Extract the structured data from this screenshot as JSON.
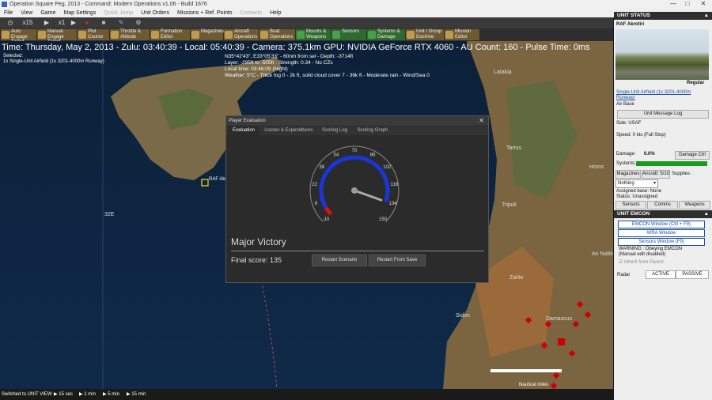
{
  "window": {
    "title": "Operation Square Peg, 2013 - Command: Modern Operations v1.06 - Build 1676",
    "min": "—",
    "max": "□",
    "close": "✕"
  },
  "menu": [
    "File",
    "View",
    "Game",
    "Map Settings",
    "Quick Jump",
    "Unit Orders",
    "Missions + Ref. Points",
    "Contacts",
    "Help"
  ],
  "menu_disabled": [
    false,
    false,
    false,
    false,
    true,
    false,
    false,
    true,
    false
  ],
  "toolbar1": {
    "speed_label": "x15",
    "speed2_label": "x1"
  },
  "toolbar2": [
    {
      "label": "Auto Engage Target",
      "color": "brown"
    },
    {
      "label": "Manual Engage Target",
      "color": "brown"
    },
    {
      "label": "Plot Course",
      "color": "brown"
    },
    {
      "label": "Throttle & Altitude",
      "color": "brown"
    },
    {
      "label": "Formation Editor",
      "color": "brown"
    },
    {
      "label": "Magazines",
      "color": "brown"
    },
    {
      "label": "Aircraft Operations",
      "color": "brown"
    },
    {
      "label": "Boat Operations",
      "color": "brown"
    },
    {
      "label": "Mounts & Weapons",
      "color": "green"
    },
    {
      "label": "Sensors",
      "color": "green"
    },
    {
      "label": "Systems & Damage",
      "color": "green"
    },
    {
      "label": "Unit / Group Doctrine",
      "color": "brown"
    },
    {
      "label": "Mission Editor",
      "color": "brown"
    }
  ],
  "status": {
    "line": "Time: Thursday, May 2, 2013 - Zulu: 03:40:39 - Local: 05:40:39 - Camera: 375.1km GPU: NVIDIA GeForce RTX 4060 - AU Count: 160 - Pulse Time: 0ms"
  },
  "selected": {
    "line1": "Selected:",
    "line2": "1x Single-Unit Airfield (1x 3201-4000m Runway)"
  },
  "cursor_info": {
    "line1": "N35°42'43\", E33°05'33\" - 60nm from sel - Depth: -3714ft",
    "line2": "Layer: -295ft to -505ft - Strength: 0.34 - No CZs",
    "line3": "Local time: 03:46:09 (Night)",
    "line4": "Weather: 5°C - Thick fog 0 - 2k ft, solid cloud cover 7 - 36k ft - Moderate rain - Wind/Sea 0"
  },
  "map_labels": {
    "latakia": "Latakia",
    "tartus": "Tartus",
    "homs": "Homs",
    "tripoli": "Tripoli",
    "zahle": "Zahle",
    "sidon": "Sidon",
    "an_nabk": "An Nabk",
    "damascus": "Damascus",
    "lon": "32E",
    "airfield": "RAF Akr...",
    "scale": "Nautical miles"
  },
  "bottom": {
    "status": "Switched to UNIT VIEW",
    "t1": "15 sec",
    "t2": "1 min",
    "t3": "5 min",
    "t4": "15 min"
  },
  "dialog": {
    "title": "Player Evaluation",
    "tabs": [
      "Evaluation",
      "Losses & Expenditures",
      "Scoring Log",
      "Scoring Graph"
    ],
    "gauge_ticks": [
      "-10",
      "6",
      "22",
      "38",
      "54",
      "70",
      "86",
      "102",
      "118",
      "134",
      "150"
    ],
    "gauge_min": -10,
    "gauge_max": 150,
    "score_value": 135,
    "result": "Major Victory",
    "final_score": "Final score: 135",
    "restart_scenario": "Restart Scenario",
    "restart_save": "Restart From Save"
  },
  "panel": {
    "header": "UNIT STATUS",
    "unit_name": "RAF Akrotiri",
    "regular": "Regular",
    "unit_type": "Single-Unit Airfield (1x 3201-4000m Runway)",
    "unit_class": "Air Base",
    "message_log": "Unit Message Log",
    "side": "Side: USAF",
    "speed": "Speed: 0 kts (Full Stop)",
    "damage_label": "Damage:",
    "damage_value": "0.0%",
    "damage_ctrl": "Damage Ctrl",
    "systems_label": "Systems:",
    "systems_pct": 1.0,
    "magazines": "Magazines",
    "aircraft": "Aircraft: 5/10",
    "supplies": "Supplies :",
    "assign_value": "Nothing",
    "assigned_base": "Assigned base: None",
    "status_line": "Status: Unassigned",
    "tab_sensors": "Sensors",
    "tab_comms": "Comms",
    "tab_weapons": "Weapons",
    "emcon_header": "UNIT EMCON",
    "emcon_window": "EMCON Window (Ctrl + F9)",
    "wra_window": "WRA Window",
    "sensors_window": "Sensors Window (F9)",
    "warning1": "WARNING : Obeying EMCON",
    "warning2": "(Manual edit disabled)",
    "inherit": "Inherit from Parent",
    "radar": "Radar",
    "active": "ACTIVE",
    "passive": "PASSIVE"
  },
  "colors": {
    "gauge_blue": "#1a35d8",
    "gauge_red": "#e01010",
    "systems_green": "#1a9a1a",
    "contact_red": "#d00000"
  }
}
